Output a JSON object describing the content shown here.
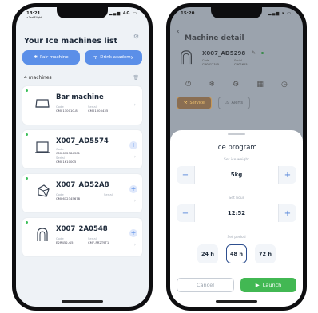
{
  "left_screen": {
    "status": {
      "time": "13:21",
      "sub": "◂ TestFlight",
      "icons": "▂▄▆ 4G ▭"
    },
    "title": "Your Ice machines list",
    "buttons": {
      "pair": "Pair machine",
      "academy": "Drink academy"
    },
    "machines_count": "4 machines",
    "machines": [
      {
        "name": "Bar machine",
        "code_label": "Code",
        "code": "CM0110010-8",
        "serial_label": "Serial",
        "serial": "CM01005435",
        "has_plus": false
      },
      {
        "name": "X007_AD5574",
        "code_label": "Code",
        "code": "CM0612384301",
        "serial_label": "Serial",
        "serial": "CM01610005",
        "has_plus": true
      },
      {
        "name": "X007_AD52A8",
        "code_label": "Code",
        "code": "CM0612345678",
        "serial_label": "Serial",
        "serial": "",
        "has_plus": true
      },
      {
        "name": "X007_2A0548",
        "code_label": "Code",
        "code": "E2R452-G5",
        "serial_label": "Serial",
        "serial": "CMF-PR2T9T1",
        "has_plus": true
      }
    ],
    "colors": {
      "accent": "#5b8fe8",
      "online": "#3cbf5a"
    }
  },
  "right_screen": {
    "status": {
      "time": "15:20",
      "icons": "▂▄▆ ▾ ▭"
    },
    "header": {
      "title": "Machine detail"
    },
    "machine": {
      "name": "X007_AD5298",
      "code_label": "Code",
      "code": "CM0612345",
      "serial_label": "Serial",
      "serial": "CM01625"
    },
    "tabs": {
      "service": "Service",
      "alerts": "Alerts"
    },
    "sheet": {
      "title": "Ice program",
      "weight_label": "Set ice weight",
      "weight_value": "5kg",
      "hour_label": "Set hour",
      "hour_value": "12:52",
      "period_label": "Set period",
      "periods": [
        "24 h",
        "48 h",
        "72 h"
      ],
      "selected_period": "48 h",
      "cancel": "Cancel",
      "launch": "Launch"
    },
    "colors": {
      "launch": "#42b853",
      "selected": "#2e4f8f"
    }
  }
}
